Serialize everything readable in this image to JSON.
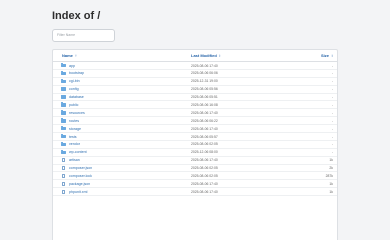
{
  "page": {
    "title": "Index of /",
    "filter_placeholder": "Filter Name"
  },
  "table": {
    "headers": {
      "name": "Name",
      "name_arrow": "↑",
      "modified": "Last Modified",
      "modified_arrow": "↕",
      "size": "Size",
      "size_arrow": "↕"
    },
    "rows": [
      {
        "type": "folder",
        "name": "app",
        "modified": "2025-08-06 17:40",
        "size": "-"
      },
      {
        "type": "folder",
        "name": "bootstrap",
        "modified": "2025-08-06 06:06",
        "size": "-"
      },
      {
        "type": "folder",
        "name": "cgi-bin",
        "modified": "2025-12-31 19:00",
        "size": "-"
      },
      {
        "type": "folder",
        "name": "config",
        "modified": "2025-08-06 05:56",
        "size": "-"
      },
      {
        "type": "folder",
        "name": "database",
        "modified": "2025-08-06 05:51",
        "size": "-"
      },
      {
        "type": "folder",
        "name": "public",
        "modified": "2025-08-06 16:08",
        "size": "-"
      },
      {
        "type": "folder",
        "name": "resources",
        "modified": "2025-08-06 17:40",
        "size": "-"
      },
      {
        "type": "folder",
        "name": "routes",
        "modified": "2025-08-06 06:22",
        "size": "-"
      },
      {
        "type": "folder",
        "name": "storage",
        "modified": "2025-08-06 17:40",
        "size": "-"
      },
      {
        "type": "folder",
        "name": "tests",
        "modified": "2025-08-06 05:57",
        "size": "-"
      },
      {
        "type": "folder",
        "name": "vendor",
        "modified": "2025-08-06 02:05",
        "size": "-"
      },
      {
        "type": "folder",
        "name": "wp-content",
        "modified": "2025-12-06 08:00",
        "size": "-"
      },
      {
        "type": "file",
        "name": "artisan",
        "modified": "2025-08-06 17:40",
        "size": "1k"
      },
      {
        "type": "file",
        "name": "composer.json",
        "modified": "2025-08-06 02:05",
        "size": "2k"
      },
      {
        "type": "file",
        "name": "composer.lock",
        "modified": "2025-08-06 02:05",
        "size": "287k"
      },
      {
        "type": "file",
        "name": "package.json",
        "modified": "2025-08-06 17:40",
        "size": "1k"
      },
      {
        "type": "file",
        "name": "phpunit.xml",
        "modified": "2025-08-06 17:40",
        "size": "1k"
      }
    ]
  },
  "colors": {
    "link": "#2f6fb0",
    "header": "#2563a8",
    "folder_icon": "#6aa9e0",
    "background": "#f3f4f6"
  }
}
